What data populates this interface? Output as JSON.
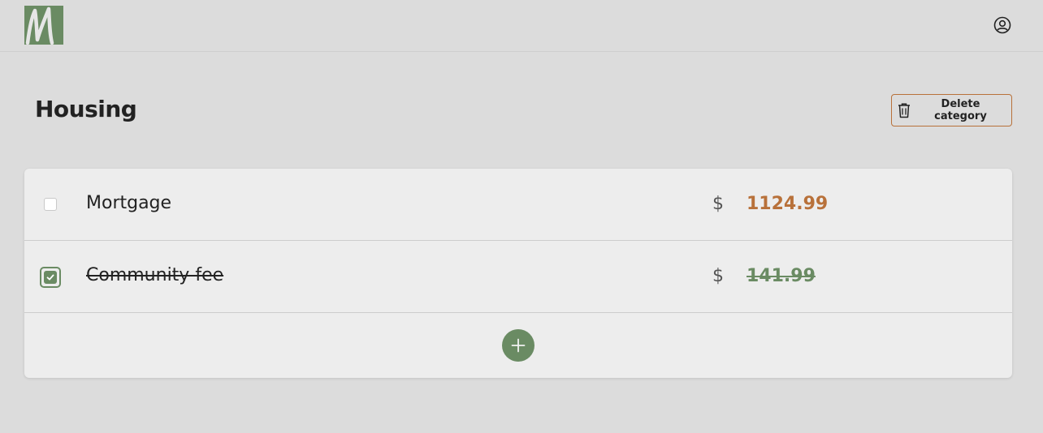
{
  "header": {
    "logo_letter": "M",
    "account_icon": "user-circle-icon"
  },
  "page": {
    "title": "Housing",
    "delete_label": "Delete category",
    "delete_icon": "trash-icon"
  },
  "items": [
    {
      "name": "Mortgage",
      "currency": "$",
      "amount": "1124.99",
      "checked": false
    },
    {
      "name": "Community fee",
      "currency": "$",
      "amount": "141.99",
      "checked": true
    }
  ],
  "add_icon": "plus-icon",
  "colors": {
    "brand_green": "#6a8b63",
    "accent_orange": "#b8713a",
    "background": "#dcdcdc",
    "card": "#ededed"
  }
}
